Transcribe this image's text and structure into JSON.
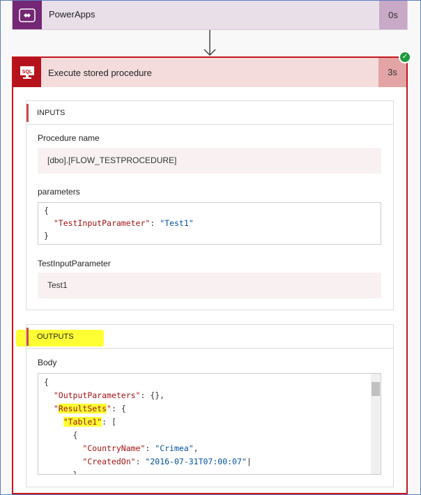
{
  "trigger": {
    "title": "PowerApps",
    "duration": "0s",
    "icon": "powerapps-icon",
    "color": "#742774"
  },
  "action": {
    "title": "Execute stored procedure",
    "duration": "3s",
    "icon": "sql-icon",
    "status": "succeeded",
    "color": "#b5121b"
  },
  "inputs": {
    "header": "INPUTS",
    "procedure_label": "Procedure name",
    "procedure_value": "[dbo].[FLOW_TESTPROCEDURE]",
    "parameters_label": "parameters",
    "parameters_lines": [
      "{",
      "\"TestInputParameter\"",
      ": ",
      "\"Test1\"",
      "}"
    ],
    "param_label": "TestInputParameter",
    "param_value": "Test1"
  },
  "outputs": {
    "header": "OUTPUTS",
    "body_label": "Body",
    "code": {
      "open": "{",
      "k1": "\"OutputParameters\"",
      "v1": ": {},",
      "k2": "ResultSets",
      "v2": ": {",
      "k3": "\"Table1\"",
      "v3": ": [",
      "o": "{",
      "k4": "\"CountryName\"",
      "v4": "\"Crimea\"",
      "k5": "\"CreatedOn\"",
      "v5": "\"2016-07-31T07:00:07\"",
      "c": "},"
    }
  }
}
